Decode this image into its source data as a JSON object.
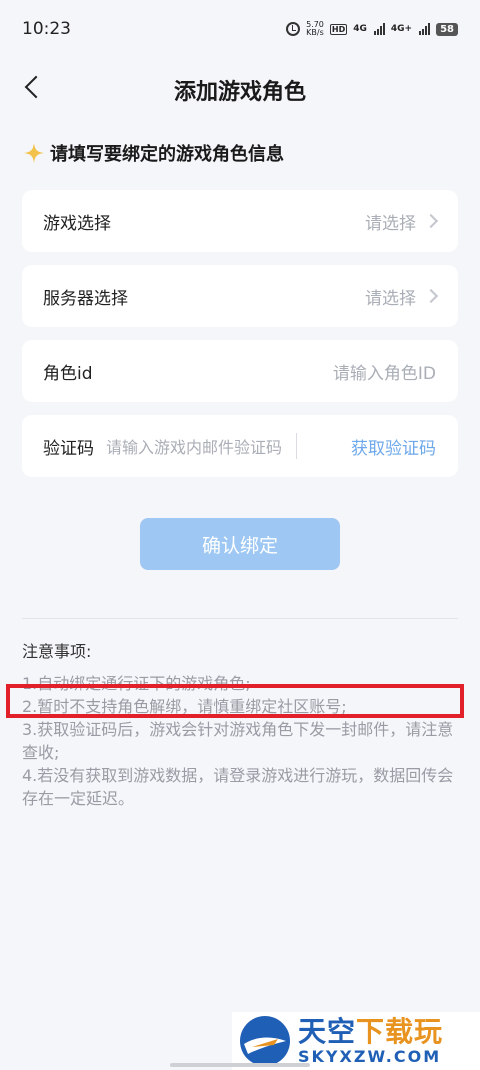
{
  "status_bar": {
    "time": "10:23",
    "net_speed_value": "5.70",
    "net_speed_unit": "KB/s",
    "hd_badge": "HD",
    "net1": "4G",
    "net2": "4G+",
    "battery": "58"
  },
  "header": {
    "title": "添加游戏角色"
  },
  "section": {
    "heading": "请填写要绑定的游戏角色信息"
  },
  "form": {
    "game": {
      "label": "游戏选择",
      "placeholder": "请选择"
    },
    "server": {
      "label": "服务器选择",
      "placeholder": "请选择"
    },
    "role_id": {
      "label": "角色id",
      "placeholder": "请输入角色ID"
    },
    "verify": {
      "label": "验证码",
      "placeholder": "请输入游戏内邮件验证码",
      "get_code": "获取验证码"
    }
  },
  "confirm_button": "确认绑定",
  "notes": {
    "title": "注意事项:",
    "items": [
      "1.自动绑定通行证下的游戏角色;",
      "2.暂时不支持角色解绑，请慎重绑定社区账号;",
      "3.获取验证码后，游戏会针对游戏角色下发一封邮件，请注意查收;",
      "4.若没有获取到游戏数据，请登录游戏进行游玩，数据回传会存在一定延迟。"
    ]
  },
  "watermark": {
    "cn_main": "天空",
    "cn_accent": "下载玩",
    "en": "SKYXZW.COM"
  },
  "colors": {
    "accent": "#6da8ea",
    "button": "#9ec8f3",
    "highlight": "#e2202a",
    "background": "#f5f6fa"
  },
  "icons": [
    "alarm-icon",
    "back-icon",
    "sparkle-icon",
    "chevron-right-icon",
    "watermark-logo"
  ]
}
